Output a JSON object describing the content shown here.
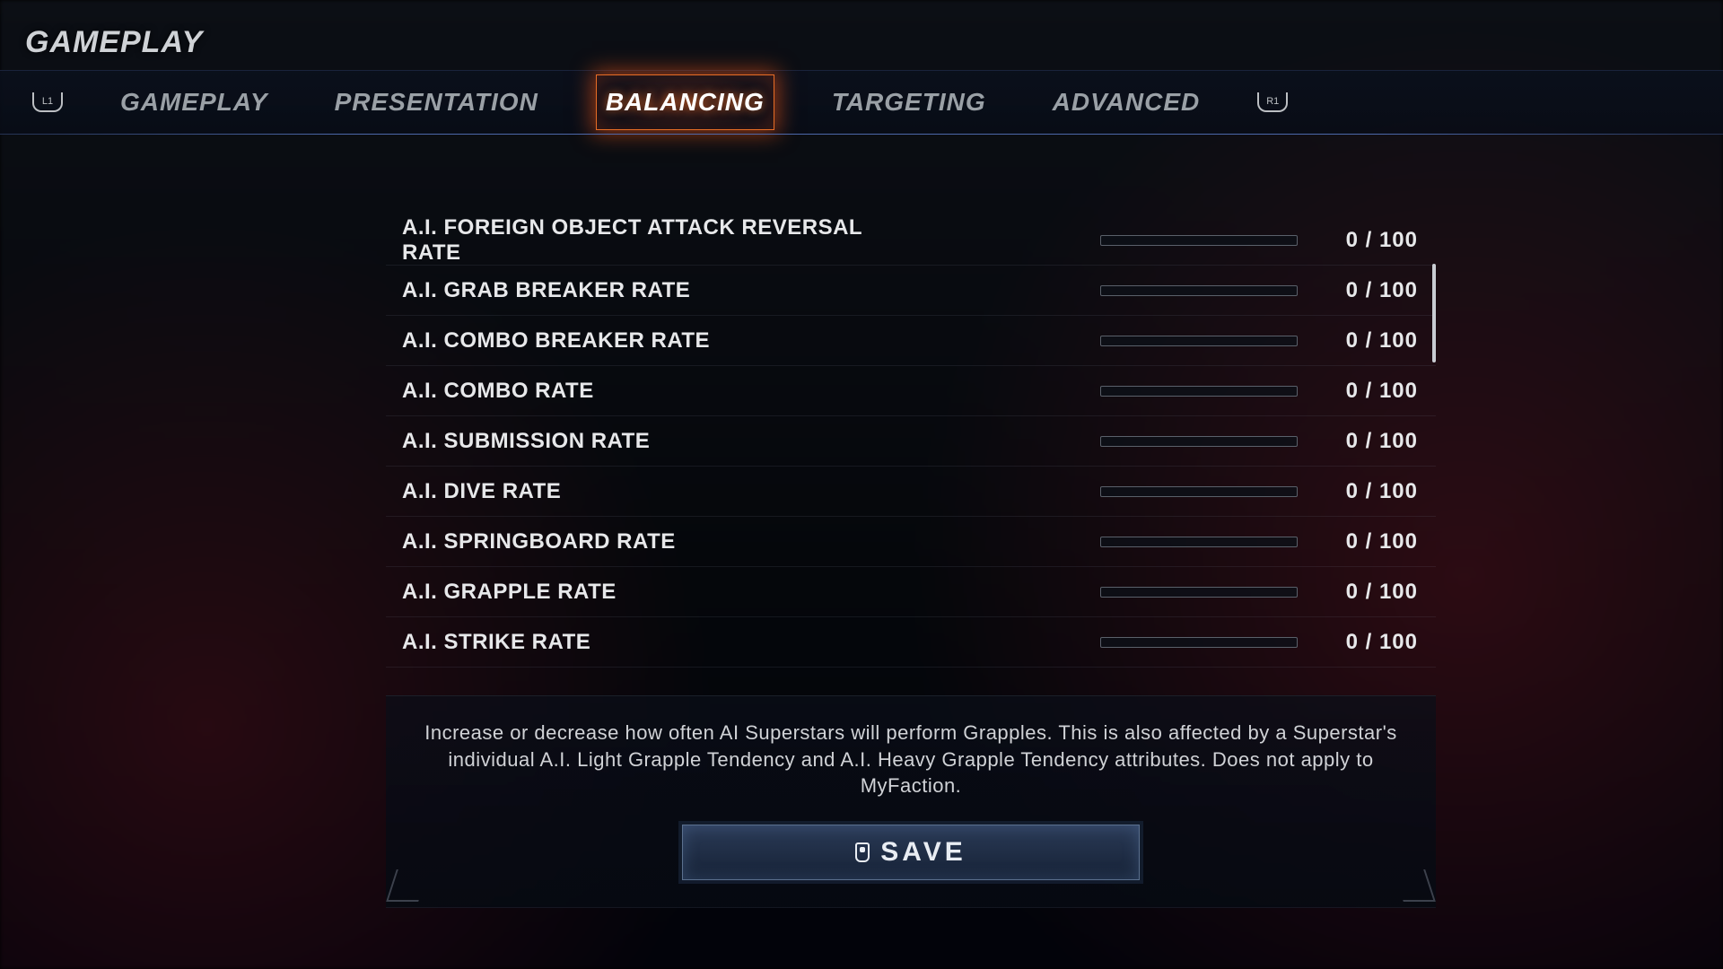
{
  "header": {
    "title": "GAMEPLAY"
  },
  "shoulders": {
    "left": "L1",
    "right": "R1"
  },
  "tabs": [
    {
      "label": "GAMEPLAY",
      "active": false
    },
    {
      "label": "PRESENTATION",
      "active": false
    },
    {
      "label": "BALANCING",
      "active": true
    },
    {
      "label": "TARGETING",
      "active": false
    },
    {
      "label": "ADVANCED",
      "active": false
    }
  ],
  "settings": [
    {
      "label": "A.I. FOREIGN OBJECT ATTACK REVERSAL RATE",
      "value": 0,
      "max": 100
    },
    {
      "label": "A.I. GRAB BREAKER RATE",
      "value": 0,
      "max": 100
    },
    {
      "label": "A.I. COMBO BREAKER RATE",
      "value": 0,
      "max": 100
    },
    {
      "label": "A.I. COMBO RATE",
      "value": 0,
      "max": 100
    },
    {
      "label": "A.I. SUBMISSION RATE",
      "value": 0,
      "max": 100
    },
    {
      "label": "A.I. DIVE RATE",
      "value": 0,
      "max": 100
    },
    {
      "label": "A.I. SPRINGBOARD RATE",
      "value": 0,
      "max": 100
    },
    {
      "label": "A.I. GRAPPLE RATE",
      "value": 0,
      "max": 100
    },
    {
      "label": "A.I. STRIKE RATE",
      "value": 0,
      "max": 100
    }
  ],
  "description": "Increase or decrease how often AI Superstars will perform Grapples. This is also affected by a Superstar's individual A.I. Light Grapple Tendency and A.I. Heavy Grapple Tendency attributes. Does not apply to MyFaction.",
  "save_label": "SAVE"
}
